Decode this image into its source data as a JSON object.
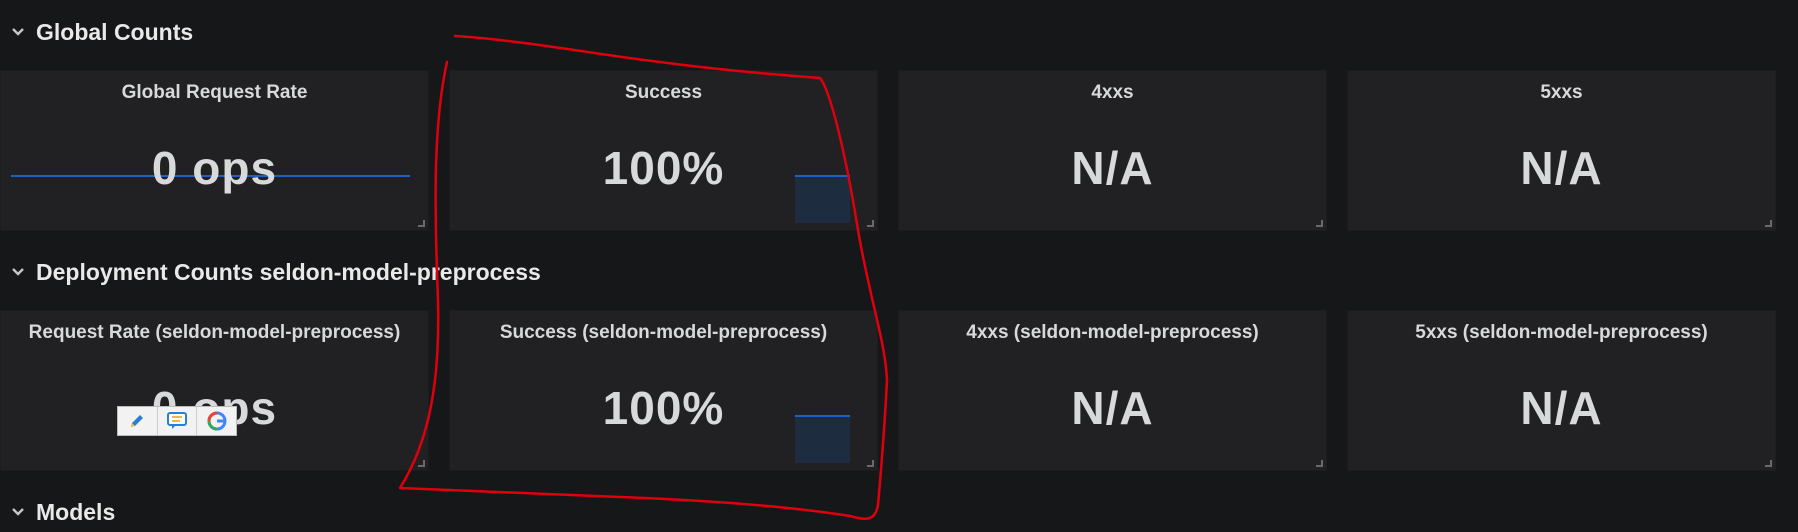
{
  "rows": [
    {
      "title": "Global Counts"
    },
    {
      "title": "Deployment Counts seldon-model-preprocess"
    },
    {
      "title": "Models"
    }
  ],
  "global_panels": [
    {
      "title": "Global Request Rate",
      "value": "0 ops"
    },
    {
      "title": "Success",
      "value": "100%"
    },
    {
      "title": "4xxs",
      "value": "N/A"
    },
    {
      "title": "5xxs",
      "value": "N/A"
    }
  ],
  "deployment_panels": [
    {
      "title": "Request Rate (seldon-model-preprocess)",
      "value": "0 ops"
    },
    {
      "title": "Success (seldon-model-preprocess)",
      "value": "100%"
    },
    {
      "title": "4xxs (seldon-model-preprocess)",
      "value": "N/A"
    },
    {
      "title": "5xxs (seldon-model-preprocess)",
      "value": "N/A"
    }
  ],
  "icons": {
    "row_toggle": "chevron-down-icon",
    "extension_edit": "pencil-icon",
    "extension_comment": "comment-icon",
    "extension_google": "google-icon"
  },
  "colors": {
    "background": "#161719",
    "panel": "#212124",
    "sparkline": "#1f60c4",
    "annotation": "#e0000d"
  }
}
